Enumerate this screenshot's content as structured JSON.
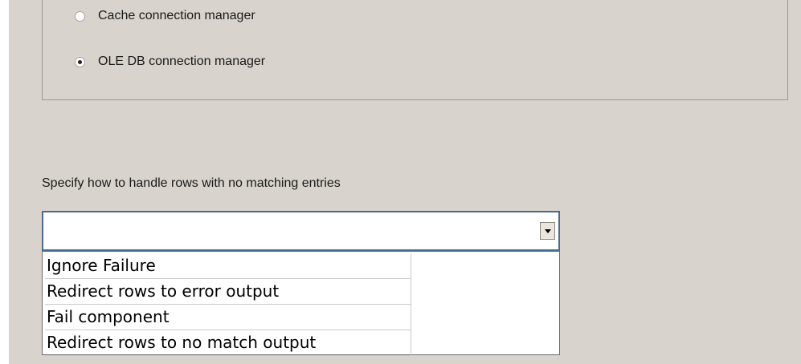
{
  "connection_type": {
    "options": [
      {
        "label": "Cache connection manager",
        "selected": false
      },
      {
        "label": "OLE DB connection manager",
        "selected": true
      }
    ]
  },
  "no_match": {
    "label": "Specify how to handle rows with no matching entries",
    "combo_value": "",
    "dropdown_icon": "chevron-down-icon",
    "options": [
      "Ignore Failure",
      "Redirect rows to error output",
      "Fail component",
      "Redirect rows to no match output"
    ]
  },
  "colors": {
    "window_background": "#d8d3cc",
    "combo_focus_border": "#4a6c8f"
  }
}
